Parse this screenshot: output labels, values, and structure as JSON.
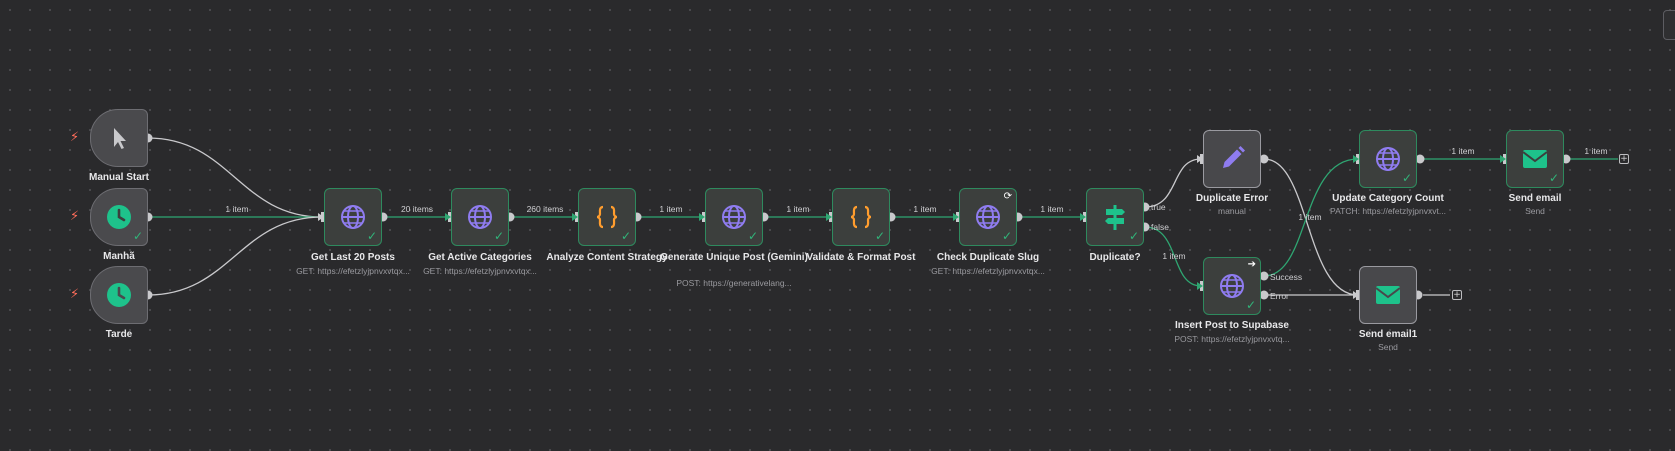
{
  "nodes": {
    "manual_start": {
      "label": "Manual Start",
      "icon": "cursor-icon"
    },
    "manha": {
      "label": "Manhã",
      "icon": "clock-icon"
    },
    "tarde": {
      "label": "Tarde",
      "icon": "clock-icon"
    },
    "get_last_posts": {
      "label": "Get Last 20 Posts",
      "sub": "GET: https://efetzlyjpnvxvtqx...",
      "icon": "globe-icon"
    },
    "get_active_categories": {
      "label": "Get Active Categories",
      "sub": "GET: https://efetzlyjpnvxvtqx...",
      "icon": "globe-icon"
    },
    "analyze_content": {
      "label": "Analyze Content Strategy",
      "icon": "code-braces-icon"
    },
    "generate_post": {
      "label": "Generate Unique Post (Gemini)",
      "sub": "POST: https://generativelang...",
      "icon": "globe-icon"
    },
    "validate_format": {
      "label": "Validate & Format Post",
      "icon": "code-braces-icon"
    },
    "check_duplicate": {
      "label": "Check Duplicate Slug",
      "sub": "GET: https://efetzlyjpnvxvtqx...",
      "icon": "globe-icon"
    },
    "duplicate_if": {
      "label": "Duplicate?",
      "icon": "signpost-icon"
    },
    "duplicate_error": {
      "label": "Duplicate Error",
      "sub": "manual",
      "icon": "pencil-icon"
    },
    "insert_post": {
      "label": "Insert Post to Supabase",
      "sub": "POST: https://efetzlyjpnvxvtq...",
      "icon": "globe-icon"
    },
    "update_category": {
      "label": "Update Category Count",
      "sub": "PATCH: https://efetzlyjpnvxvt...",
      "icon": "globe-icon"
    },
    "send_email": {
      "label": "Send email",
      "sub": "Send",
      "icon": "envelope-icon"
    },
    "send_email1": {
      "label": "Send email1",
      "sub": "Send",
      "icon": "envelope-icon"
    }
  },
  "edges": {
    "manha_to_get": "1 item",
    "get_to_categories": "20 items",
    "categories_to_analyze": "260 items",
    "analyze_to_generate": "1 item",
    "generate_to_validate": "1 item",
    "validate_to_check": "1 item",
    "check_to_if": "1 item",
    "if_false_to_insert": "1 item",
    "insert_to_update": "1 item",
    "update_to_send": "1 item",
    "send_out": "1 item"
  },
  "ports": {
    "true": "true",
    "false": "false",
    "success": "Success",
    "error": "Error"
  },
  "colors": {
    "canvas": "#2a2a2c",
    "success": "#31b57a",
    "trigger_bolt": "#ff6d5a",
    "globe": "#8f7cf0",
    "code": "#ff9d2e",
    "if": "#1ec28b",
    "email": "#1ec28b",
    "edit": "#8f7cf0"
  }
}
